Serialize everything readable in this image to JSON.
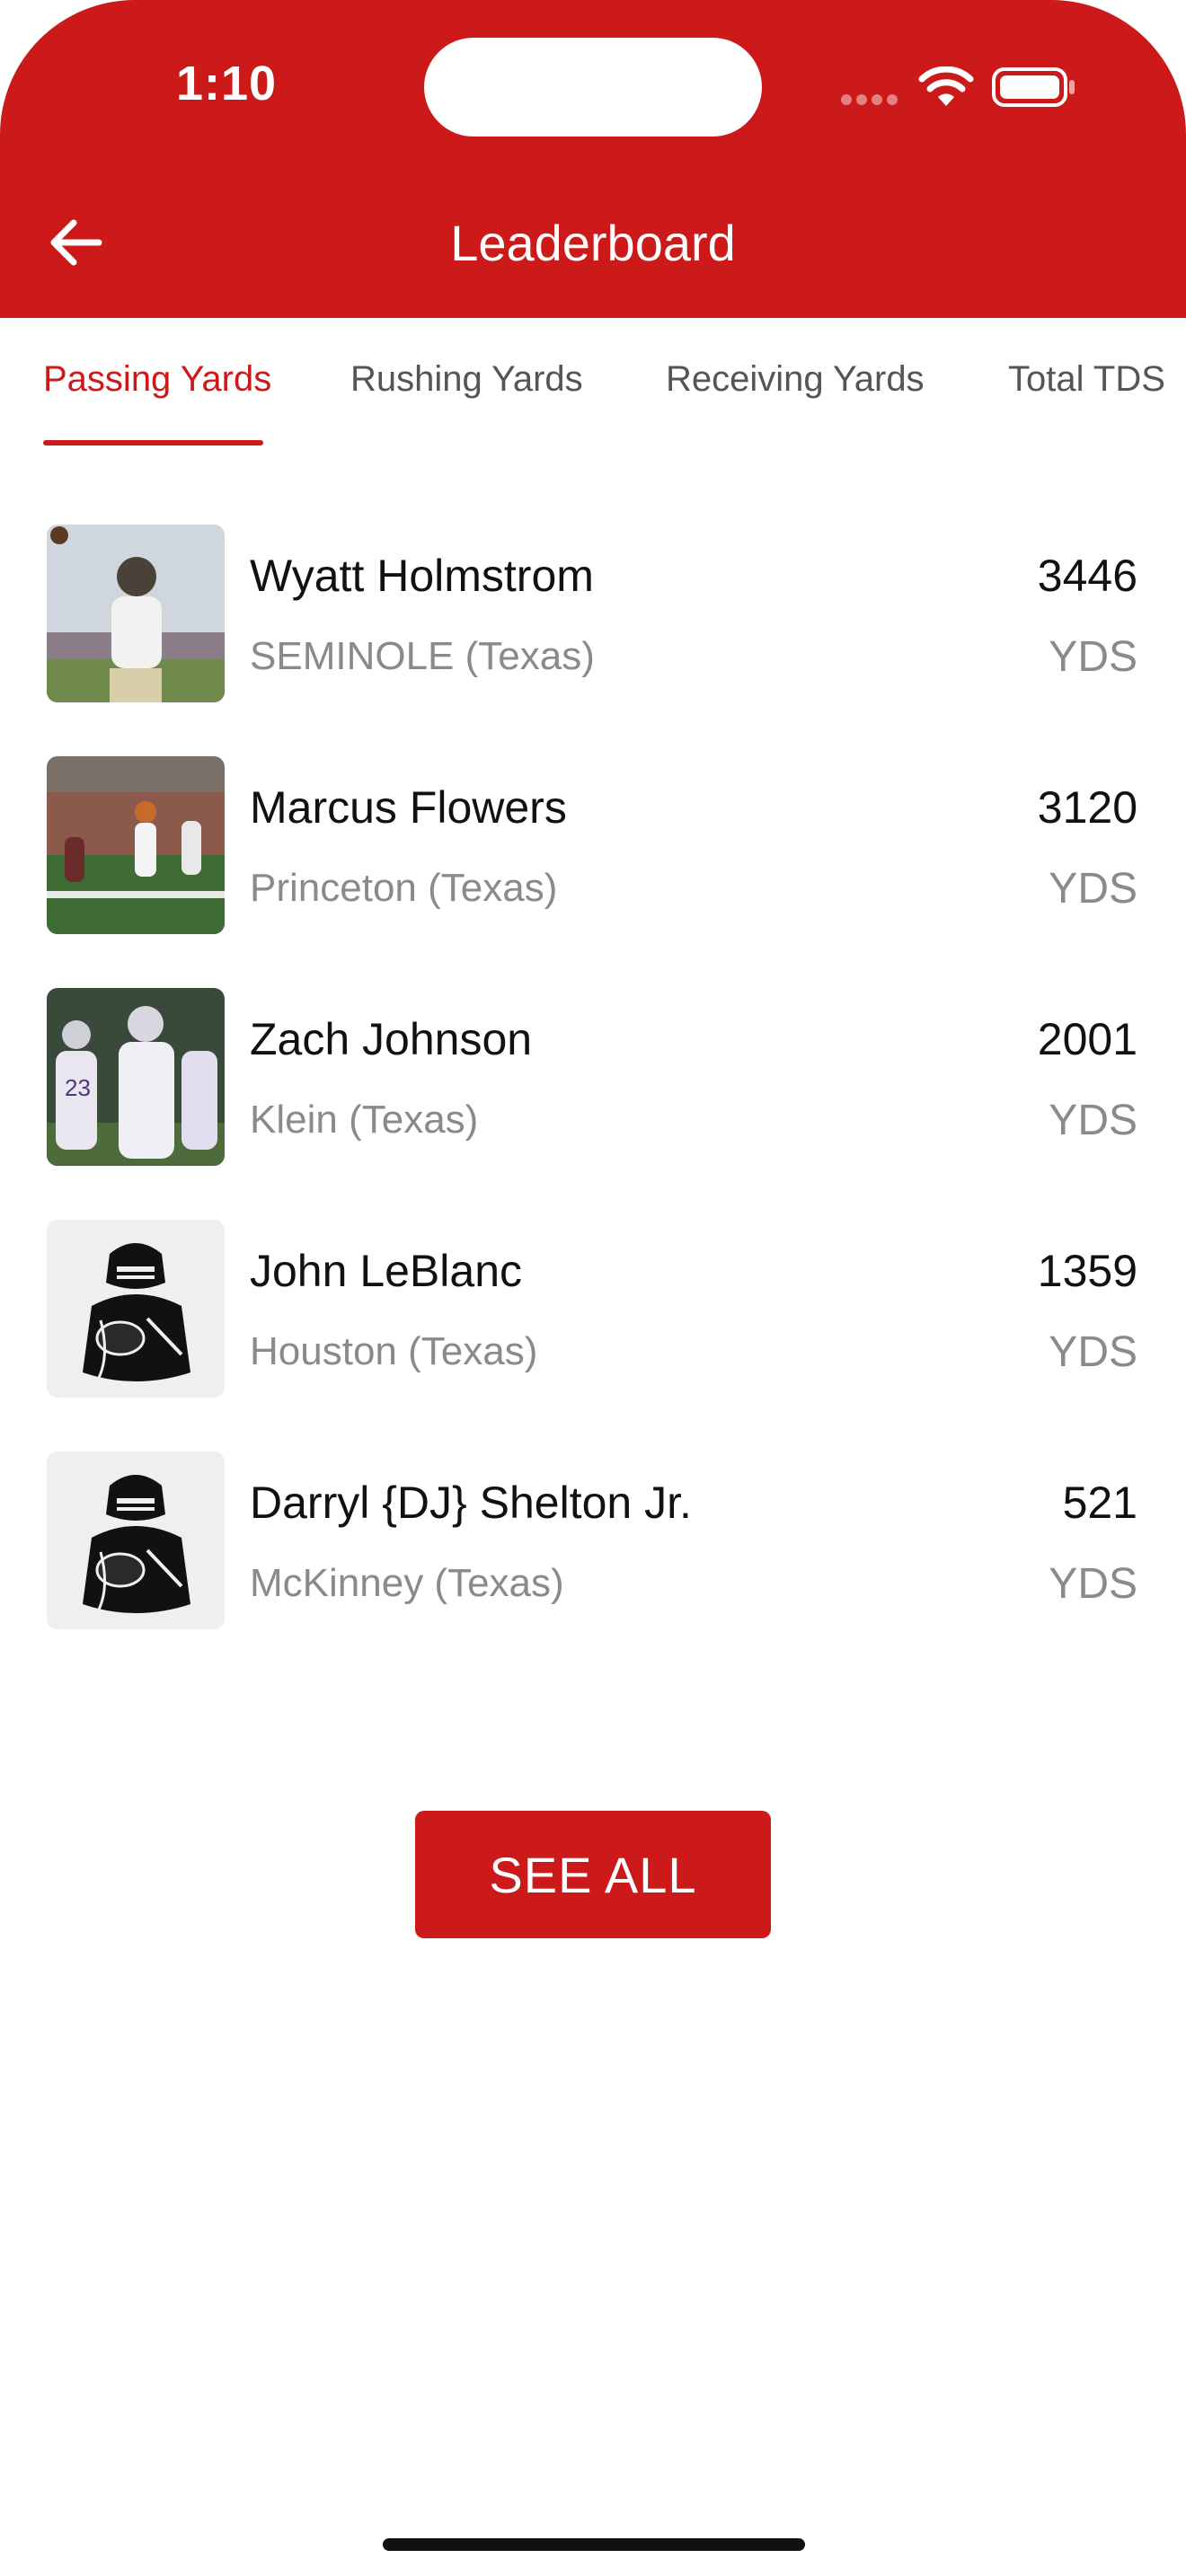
{
  "status_bar": {
    "time": "1:10"
  },
  "header": {
    "title": "Leaderboard"
  },
  "tabs": [
    {
      "label": "Passing Yards",
      "active": true
    },
    {
      "label": "Rushing Yards",
      "active": false
    },
    {
      "label": "Receiving Yards",
      "active": false
    },
    {
      "label": "Total TDS",
      "active": false
    }
  ],
  "players": [
    {
      "name": "Wyatt Holmstrom",
      "school": "SEMINOLE (Texas)",
      "value": "3446",
      "unit": "YDS",
      "image": "player-photo"
    },
    {
      "name": "Marcus Flowers",
      "school": "Princeton (Texas)",
      "value": "3120",
      "unit": "YDS",
      "image": "player-photo"
    },
    {
      "name": "Zach Johnson",
      "school": "Klein (Texas)",
      "value": "2001",
      "unit": "YDS",
      "image": "player-photo"
    },
    {
      "name": "John LeBlanc",
      "school": "Houston (Texas)",
      "value": "1359",
      "unit": "YDS",
      "image": "football-player-illustration"
    },
    {
      "name": "Darryl {DJ} Shelton Jr.",
      "school": "McKinney (Texas)",
      "value": "521",
      "unit": "YDS",
      "image": "football-player-illustration"
    }
  ],
  "see_all_label": "SEE ALL",
  "colors": {
    "brand_red": "#cc1a1a",
    "secondary_text": "#8a8a8a"
  }
}
